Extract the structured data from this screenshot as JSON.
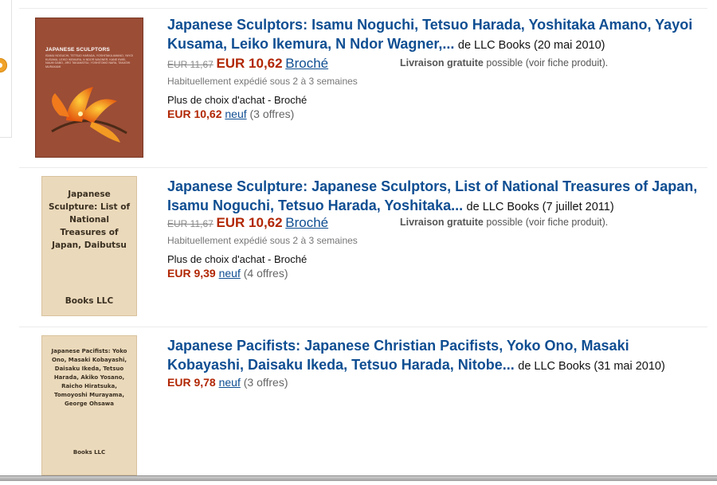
{
  "results": [
    {
      "cover": {
        "title": "JAPANESE SCULPTORS",
        "fine_print": "ISAMU NOGUCHI, TETSUO HARADA, YOSHITAKA AMANO, YAYOI KUSAMA, LEIKO IKEMURA, N NDOR WAGNER, KANE KWEI, NAUM GABO, JIRO TAKAMATSU, YOSHITOMO NARA, TAKASHI MURAKAMI"
      },
      "title_link": "Japanese Sculptors: Isamu Noguchi, Tetsuo Harada, Yoshitaka Amano, Yayoi Kusama, Leiko Ikemura, N Ndor Wagner,...",
      "byline": "de LLC Books (20 mai 2010)",
      "old_price": "EUR 11,67",
      "price": "EUR 10,62",
      "format": "Broché",
      "shipping_bold": "Livraison gratuite",
      "shipping_rest": "possible (voir fiche produit).",
      "availability": "Habituellement expédié sous 2 à 3 semaines",
      "more_choices": "Plus de choix d'achat - Broché",
      "offers_price": "EUR 10,62",
      "offers_new": "neuf",
      "offers_count": "(3 offres)"
    },
    {
      "cover": {
        "title": "Japanese Sculpture: List of National Treasures of Japan, Daibutsu",
        "publisher": "Books LLC"
      },
      "title_link": "Japanese Sculpture: Japanese Sculptors, List of National Treasures of Japan, Isamu Noguchi, Tetsuo Harada, Yoshitaka...",
      "byline": "de LLC Books (7 juillet 2011)",
      "old_price": "EUR 11,67",
      "price": "EUR 10,62",
      "format": "Broché",
      "shipping_bold": "Livraison gratuite",
      "shipping_rest": "possible (voir fiche produit).",
      "availability": "Habituellement expédié sous 2 à 3 semaines",
      "more_choices": "Plus de choix d'achat - Broché",
      "offers_price": "EUR 9,39",
      "offers_new": "neuf",
      "offers_count": "(4 offres)"
    },
    {
      "cover": {
        "title": "Japanese Pacifists: Yoko Ono, Masaki Kobayashi, Daisaku Ikeda, Tetsuo Harada, Akiko Yosano, Raicho Hiratsuka, Tomoyoshi Murayama, George Ohsawa",
        "publisher": "Books LLC"
      },
      "title_link": "Japanese Pacifists: Japanese Christian Pacifists, Yoko Ono, Masaki Kobayashi, Daisaku Ikeda, Tetsuo Harada, Nitobe...",
      "byline": "de LLC Books (31 mai 2010)",
      "offers_price": "EUR 9,78",
      "offers_new": "neuf",
      "offers_count": "(3 offres)"
    }
  ],
  "colors": {
    "link": "#0f4e92",
    "price": "#b12704",
    "badge": "#f0a32a"
  },
  "icons": {
    "rail_badge": "orange-circle-icon"
  }
}
